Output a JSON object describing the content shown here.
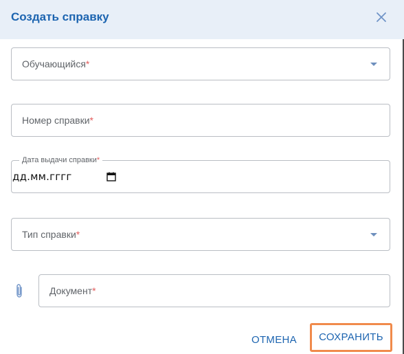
{
  "dialog": {
    "title": "Создать справку",
    "close_icon": "close-icon"
  },
  "fields": {
    "student": {
      "label": "Обучающийся",
      "required_mark": "*"
    },
    "certificate_number": {
      "label": "Номер справки",
      "required_mark": "*"
    },
    "issue_date": {
      "label": "Дата выдачи справки",
      "required_mark": "*",
      "placeholder": "дд.мм.гггг"
    },
    "certificate_type": {
      "label": "Тип справки",
      "required_mark": "*"
    },
    "document": {
      "label": "Документ",
      "required_mark": "*"
    }
  },
  "actions": {
    "cancel_label": "ОТМЕНА",
    "save_label": "СОХРАНИТЬ"
  },
  "colors": {
    "accent": "#1c64b0",
    "header_bg": "#e8eff8",
    "required": "#e25b5b",
    "save_highlight": "#f08a4b"
  }
}
